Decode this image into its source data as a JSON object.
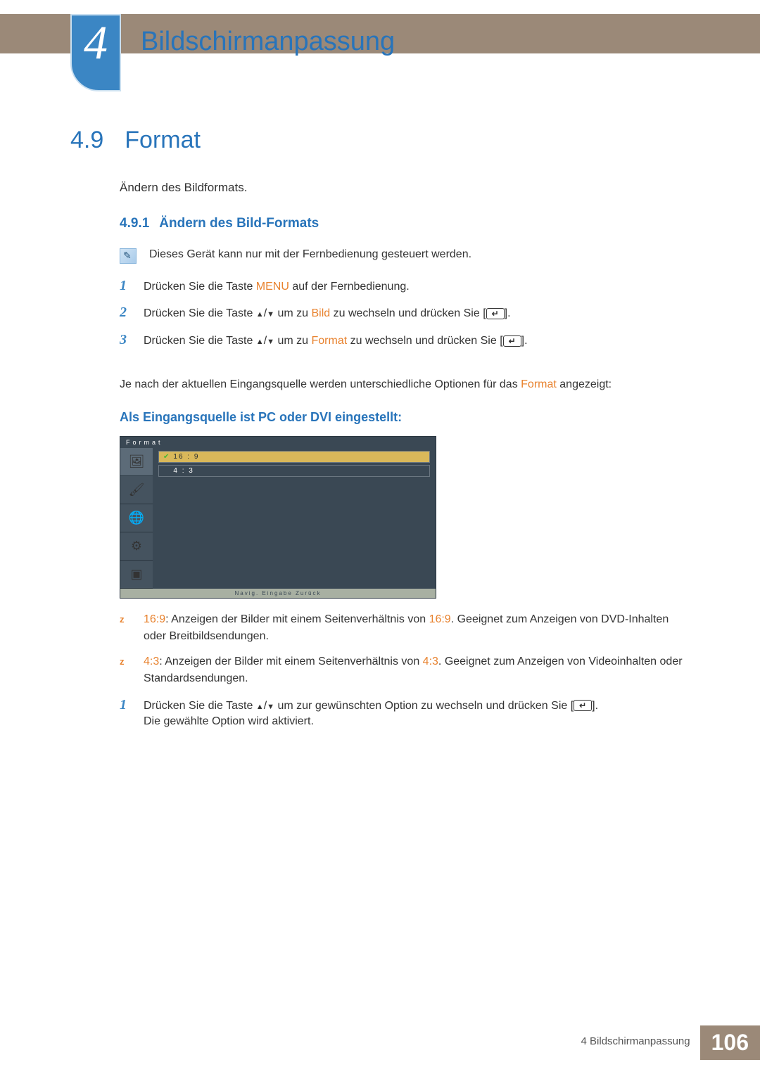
{
  "chapter": {
    "number": "4",
    "title": "Bildschirmanpassung"
  },
  "section": {
    "number": "4.9",
    "title": "Format"
  },
  "intro": "Ändern des Bildformats.",
  "subsection": {
    "number": "4.9.1",
    "title": "Ändern des Bild-Formats"
  },
  "note": "Dieses Gerät kann nur mit der Fernbedienung gesteuert werden.",
  "steps": {
    "s1_a": "Drücken Sie die Taste ",
    "s1_menu": "MENU",
    "s1_b": " auf der Fernbedienung.",
    "s2_a": "Drücken Sie die Taste ",
    "s2_b": " um zu ",
    "s2_bild": "Bild",
    "s2_c": " zu wechseln und drücken Sie [",
    "s3_a": "Drücken Sie die Taste ",
    "s3_b": " um zu ",
    "s3_format": "Format",
    "s3_c": " zu wechseln und drücken Sie ["
  },
  "para_a": "Je nach der aktuellen Eingangsquelle werden unterschiedliche Optionen für das ",
  "para_format": "Format",
  "para_b": " angezeigt:",
  "subhead": "Als Eingangsquelle ist PC oder DVI eingestellt:",
  "osd": {
    "title": "Format",
    "opt1": "16 : 9",
    "opt2": "4 : 3",
    "footer": "Navig.      Eingabe      Zurück"
  },
  "bullets": {
    "b1_label": "16:9",
    "b1_a": ": Anzeigen der Bilder mit einem Seitenverhältnis von ",
    "b1_ratio": "16:9",
    "b1_b": ". Geeignet zum Anzeigen von DVD-Inhalten oder Breitbildsendungen.",
    "b2_label": "4:3",
    "b2_a": ": Anzeigen der Bilder mit einem Seitenverhältnis von ",
    "b2_ratio": "4:3",
    "b2_b": ". Geeignet zum Anzeigen von Videoinhalten oder Standardsendungen."
  },
  "final": {
    "a": "Drücken Sie die Taste ",
    "b": " um zur gewünschten Option zu wechseln und drücken Sie [",
    "c": "Die gewählte Option wird aktiviert."
  },
  "footer": {
    "text": "4 Bildschirmanpassung",
    "page": "106"
  }
}
